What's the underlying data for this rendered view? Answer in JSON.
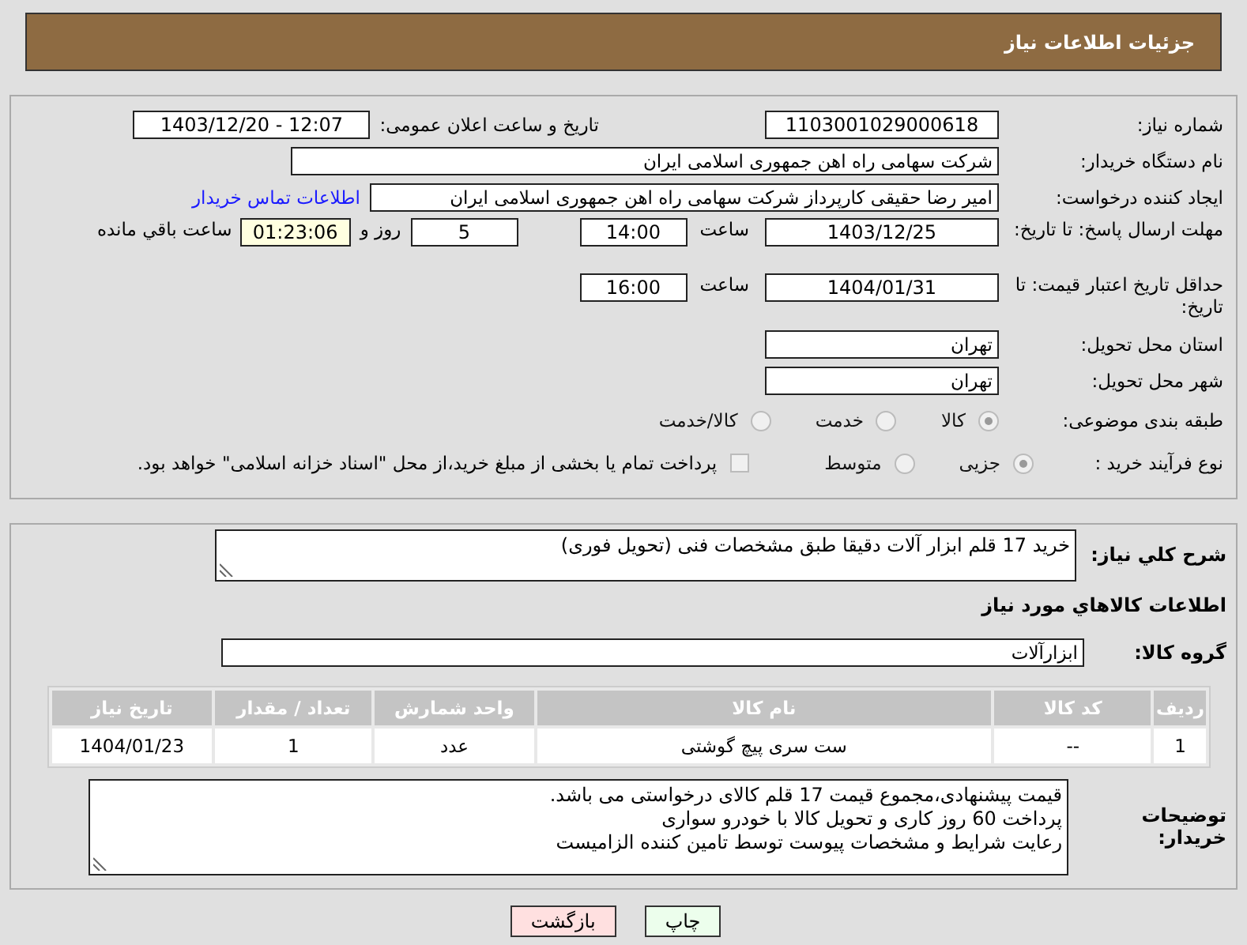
{
  "header": {
    "title": "جزئیات اطلاعات نیاز"
  },
  "need_number": {
    "label": "شماره نیاز:",
    "value": "1103001029000618"
  },
  "announce": {
    "label": "تاریخ و ساعت اعلان عمومی:",
    "value": "1403/12/20 - 12:07"
  },
  "buyer": {
    "label": "نام دستگاه خریدار:",
    "value": "شرکت سهامی راه اهن جمهوری اسلامی ایران"
  },
  "requester": {
    "label": "ایجاد کننده درخواست:",
    "value": "امیر رضا  حقیقی کارپرداز شرکت سهامی راه اهن جمهوری اسلامی ایران",
    "link": "اطلاعات تماس خریدار"
  },
  "reply_deadline": {
    "label": "مهلت ارسال پاسخ: تا تاریخ:",
    "date": "1403/12/25",
    "time_label": "ساعت",
    "time": "14:00",
    "days": "5",
    "days_label": "روز و",
    "remaining": "01:23:06",
    "remaining_label": "ساعت باقي مانده"
  },
  "price_validity": {
    "label": "حداقل تاریخ اعتبار قیمت: تا تاریخ:",
    "date": "1404/01/31",
    "time_label": "ساعت",
    "time": "16:00"
  },
  "province": {
    "label": "استان محل تحویل:",
    "value": "تهران"
  },
  "city": {
    "label": "شهر محل تحویل:",
    "value": "تهران"
  },
  "category": {
    "label": "طبقه بندی موضوعی:",
    "options": [
      {
        "label": "کالا",
        "selected": true
      },
      {
        "label": "خدمت",
        "selected": false
      },
      {
        "label": "کالا/خدمت",
        "selected": false
      }
    ]
  },
  "process": {
    "label": "نوع فرآیند خرید :",
    "options": [
      {
        "label": "جزیی",
        "selected": true
      },
      {
        "label": "متوسط",
        "selected": false
      }
    ],
    "payment": {
      "label": "پرداخت تمام یا بخشی از مبلغ خرید،از محل \"اسناد خزانه اسلامی\" خواهد بود.",
      "checked": false
    }
  },
  "description": {
    "label": "شرح کلي نیاز:",
    "value": "خرید 17 قلم ابزار آلات دقیقا طبق مشخصات فنی (تحویل فوری)"
  },
  "goods_heading": "اطلاعات کالاهاي مورد نياز",
  "goods_group": {
    "label": "گروه کالا:",
    "value": "ابزارآلات"
  },
  "table": {
    "columns": [
      "ردیف",
      "کد کالا",
      "نام کالا",
      "واحد شمارش",
      "تعداد / مقدار",
      "تاریخ نیاز"
    ],
    "rows": [
      [
        "1",
        "--",
        "ست سری پیچ گوشتی",
        "عدد",
        "1",
        "1404/01/23"
      ]
    ]
  },
  "buyer_notes": {
    "label": "توضیحات خریدار:",
    "lines": [
      "قیمت پیشنهادی،مجموع قیمت 17 قلم کالای درخواستی می باشد.",
      "پرداخت 60 روز کاری و تحویل کالا با خودرو سواری",
      "رعایت شرایط و مشخصات پیوست توسط تامین کننده الزامیست"
    ]
  },
  "buttons": [
    {
      "label": "چاپ",
      "kind": "print"
    },
    {
      "label": "بازگشت",
      "kind": "back"
    }
  ]
}
